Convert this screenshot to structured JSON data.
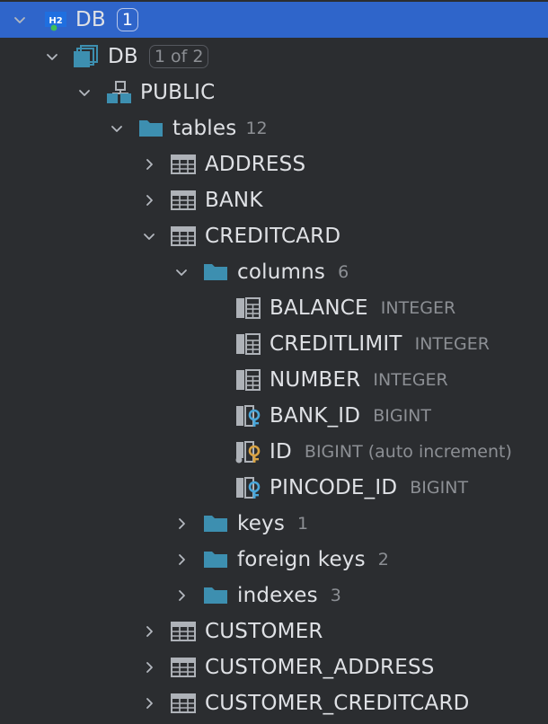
{
  "tree": {
    "root": {
      "label": "DB",
      "badge": "1",
      "icon": "h2-database-icon",
      "icon_text": "H2"
    },
    "db": {
      "label": "DB",
      "badge": "1 of 2"
    },
    "schema": {
      "label": "PUBLIC"
    },
    "tables": {
      "label": "tables",
      "count": "12"
    },
    "table_address": {
      "label": "ADDRESS"
    },
    "table_bank": {
      "label": "BANK"
    },
    "table_creditcard": {
      "label": "CREDITCARD"
    },
    "columns": {
      "label": "columns",
      "count": "6"
    },
    "col_balance": {
      "label": "BALANCE",
      "type": "INTEGER"
    },
    "col_creditlimit": {
      "label": "CREDITLIMIT",
      "type": "INTEGER"
    },
    "col_number": {
      "label": "NUMBER",
      "type": "INTEGER"
    },
    "col_bank_id": {
      "label": "BANK_ID",
      "type": "BIGINT"
    },
    "col_id": {
      "label": "ID",
      "type": "BIGINT (auto increment)"
    },
    "col_pincode_id": {
      "label": "PINCODE_ID",
      "type": "BIGINT"
    },
    "keys": {
      "label": "keys",
      "count": "1"
    },
    "foreign_keys": {
      "label": "foreign keys",
      "count": "2"
    },
    "indexes": {
      "label": "indexes",
      "count": "3"
    },
    "table_customer": {
      "label": "CUSTOMER"
    },
    "table_customer_address": {
      "label": "CUSTOMER_ADDRESS"
    },
    "table_customer_creditcard": {
      "label": "CUSTOMER_CREDITCARD"
    }
  },
  "colors": {
    "background": "#2b2d30",
    "selection": "#2f65ca",
    "folder": "#3d8fb0",
    "table_icon": "#aeb2b8",
    "key_blue": "#49a6d9",
    "key_gold": "#d9a343",
    "muted_text": "#8c8f94"
  }
}
